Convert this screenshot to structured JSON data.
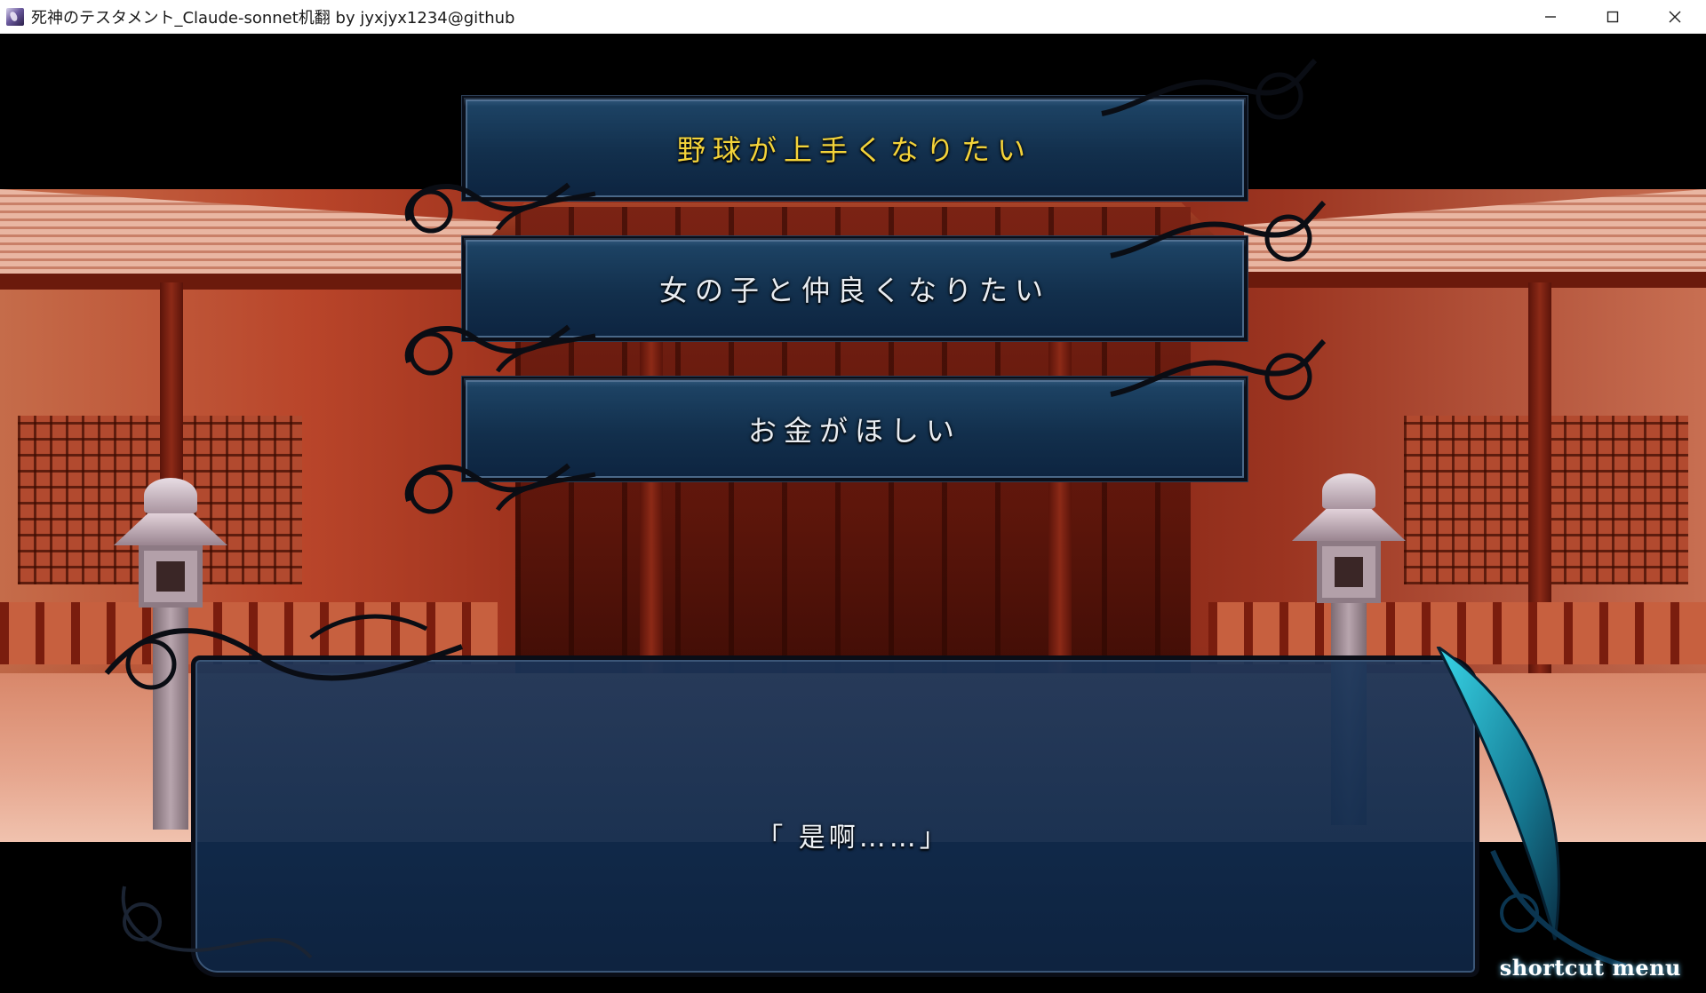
{
  "window": {
    "title": "死神のテスタメント_Claude-sonnet机翻 by jyxjyx1234@github",
    "icon": "app-icon",
    "controls": [
      "minimize",
      "maximize",
      "close"
    ]
  },
  "choices": [
    {
      "label": "野球が上手くなりたい",
      "selected": true
    },
    {
      "label": "女の子と仲良くなりたい",
      "selected": false
    },
    {
      "label": "お金がほしい",
      "selected": false
    }
  ],
  "message": {
    "text": "「 是啊……」"
  },
  "shortcut_menu": {
    "label": "shortcut menu"
  },
  "colors": {
    "choice_selected": "#f3d33a",
    "choice_text": "#e9edf2",
    "panel": "#143556",
    "accent_cyan": "#2fc4d8"
  }
}
